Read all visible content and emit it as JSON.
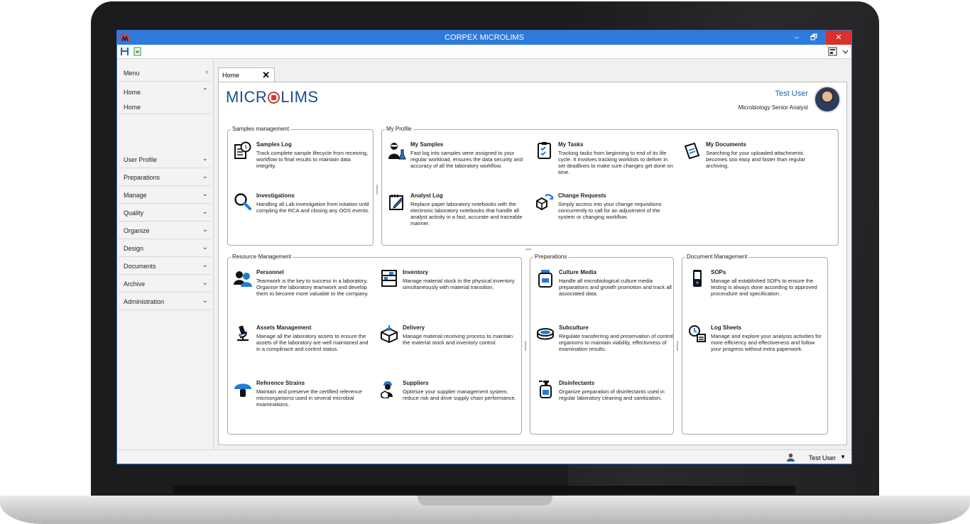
{
  "window": {
    "title": "CORPEX MICROLIMS",
    "minimize": "–",
    "maximize": "🗗",
    "close": "✕"
  },
  "sidebar": {
    "header": "Menu",
    "collapse": "‹",
    "items": [
      {
        "label": "Home",
        "chevron": "⌃"
      },
      {
        "label": "User Profile",
        "chevron": "⌄"
      },
      {
        "label": "Preparations",
        "chevron": "⌄"
      },
      {
        "label": "Manage",
        "chevron": "⌄"
      },
      {
        "label": "Quality",
        "chevron": "⌄"
      },
      {
        "label": "Organize",
        "chevron": "⌄"
      },
      {
        "label": "Design",
        "chevron": "⌄"
      },
      {
        "label": "Documents",
        "chevron": "⌄"
      },
      {
        "label": "Archive",
        "chevron": "⌄"
      },
      {
        "label": "Administration",
        "chevron": "⌄"
      }
    ],
    "subitem": "Home"
  },
  "tab": {
    "label": "Home",
    "close": "✕"
  },
  "brand": {
    "logo_pre": "MICR",
    "logo_post": "LIMS"
  },
  "user": {
    "name": "Test User",
    "role": "Microbiology Senior Analyst"
  },
  "groups": {
    "samples": "Samples management",
    "profile": "My Profile",
    "resource": "Resource Management",
    "preparations": "Preparations",
    "documents": "Document Management"
  },
  "cards": {
    "samples_log": {
      "title": "Samples Log",
      "desc": "Track complete sample lifecycle from receiving, workflow to final results to maintain data integrity."
    },
    "investigations": {
      "title": "Investigations",
      "desc": "Handling all Lab investigation from initation until compling the  RCA and closing any OOS events."
    },
    "my_samples": {
      "title": "My Samples",
      "desc": "Fast log into samples were assigned to your regular workload, ensures the data security and accuracy of all the laboratory workflow."
    },
    "my_tasks": {
      "title": "My Tasks",
      "desc": "Tracking tasks from beginning to end of its life cycle. It involves tracking worklists to deliver in set deadlines to make sure changes get done on time."
    },
    "my_documents": {
      "title": "My Documents",
      "desc": "Searching for your uploaded attachments becomes soo easy and faster than regular archiving."
    },
    "analyst_log": {
      "title": "Analyst Log",
      "desc": "Replace paper laboratory notebooks with the electronic laboratory notebooks that handle all analyst activity in a fast, accurate and traceable manner."
    },
    "change_requests": {
      "title": "Change Requests",
      "desc": "Simply access into your change requisitions concurrently to call for an adjustment of the system or changing workflow."
    },
    "personnel": {
      "title": "Personnel",
      "desc": "Teamwork is the key to success in a laboratory, Organise the laboratory teamwork and develop them to become more valuable to the company."
    },
    "inventory": {
      "title": "Inventory",
      "desc": "Manage material stock in the physical inventory simultaneously with material transition."
    },
    "assets": {
      "title": "Assets Management",
      "desc": "Manage all the laboratory assets to ensure the assets of the laboratory are well maintaned and in a compilnace and control status."
    },
    "delivery": {
      "title": "Delivery",
      "desc": "Manage material receiving process to maintain the material stock and inventory control."
    },
    "reference": {
      "title": "Reference Strains",
      "desc": "Maintain and preserve the certified reference microorganisms used in several microbial examinations."
    },
    "suppliers": {
      "title": "Suppliers",
      "desc": "Optimize your supplier management system, reduce risk and drive supply chain performance."
    },
    "culture": {
      "title": "Culture Media",
      "desc": "Handle all microbiological culture media preparations and growth promotion and track all associated data."
    },
    "subculture": {
      "title": "Subculture",
      "desc": "Regulate transferring and preservation of control organisms to maintain viability, effectivness of examination results."
    },
    "disinfectants": {
      "title": "Disinfectants",
      "desc": "Organize preparation of disinfectants used in regular laboratory cleaning and sanitization."
    },
    "sops": {
      "title": "SOPs",
      "desc": "Manage all established SOPs to ensure the testing is always done according to approved proceudure and specification."
    },
    "log_sheets": {
      "title": "Log Sheets",
      "desc": "Manage and explore your analysis activities for more efficiency and effectiveness and follow your progress without extra paperwork."
    }
  },
  "status": {
    "user": "Test User",
    "caret": "▼"
  },
  "colors": {
    "titlebar": "#2f7bdb",
    "close": "#d9312b",
    "brand": "#1a4e8f",
    "accent": "#1f61b5"
  }
}
